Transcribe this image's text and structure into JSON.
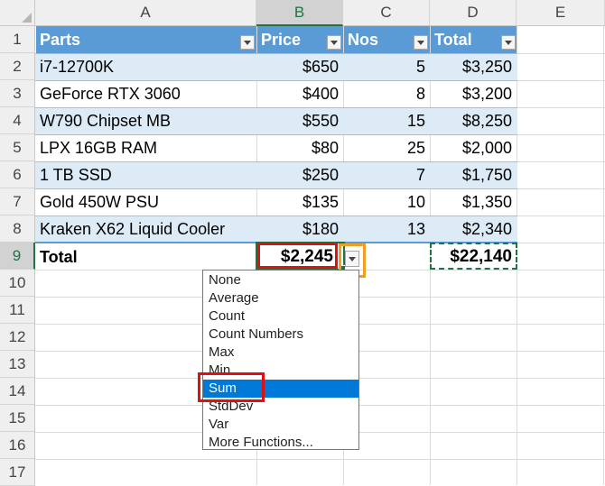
{
  "columns": [
    "A",
    "B",
    "C",
    "D",
    "E"
  ],
  "rows": [
    "1",
    "2",
    "3",
    "4",
    "5",
    "6",
    "7",
    "8",
    "9",
    "10",
    "11",
    "12",
    "13",
    "14",
    "15",
    "16",
    "17"
  ],
  "table": {
    "headers": [
      "Parts",
      "Price",
      "Nos",
      "Total"
    ],
    "rows": [
      [
        "i7-12700K",
        "$650",
        "5",
        "$3,250"
      ],
      [
        "GeForce RTX 3060",
        "$400",
        "8",
        "$3,200"
      ],
      [
        "W790 Chipset MB",
        "$550",
        "15",
        "$8,250"
      ],
      [
        "LPX 16GB RAM",
        "$80",
        "25",
        "$2,000"
      ],
      [
        "1 TB SSD",
        "$250",
        "7",
        "$1,750"
      ],
      [
        "Gold 450W PSU",
        "$135",
        "10",
        "$1,350"
      ],
      [
        "Kraken X62 Liquid Cooler",
        "$180",
        "13",
        "$2,340"
      ]
    ],
    "total_label": "Total",
    "total_price": "$2,245",
    "total_sum": "$22,140"
  },
  "dropdown": {
    "options": [
      "None",
      "Average",
      "Count",
      "Count Numbers",
      "Max",
      "Min",
      "Sum",
      "StdDev",
      "Var",
      "More Functions..."
    ],
    "highlighted": "Sum"
  },
  "colors": {
    "header_fill": "#5b9bd5",
    "band_fill": "#ddebf7",
    "selection_green": "#217346",
    "highlight_blue": "#0078d7",
    "annotation_red": "#e01010",
    "annotation_orange": "#f0a020"
  }
}
